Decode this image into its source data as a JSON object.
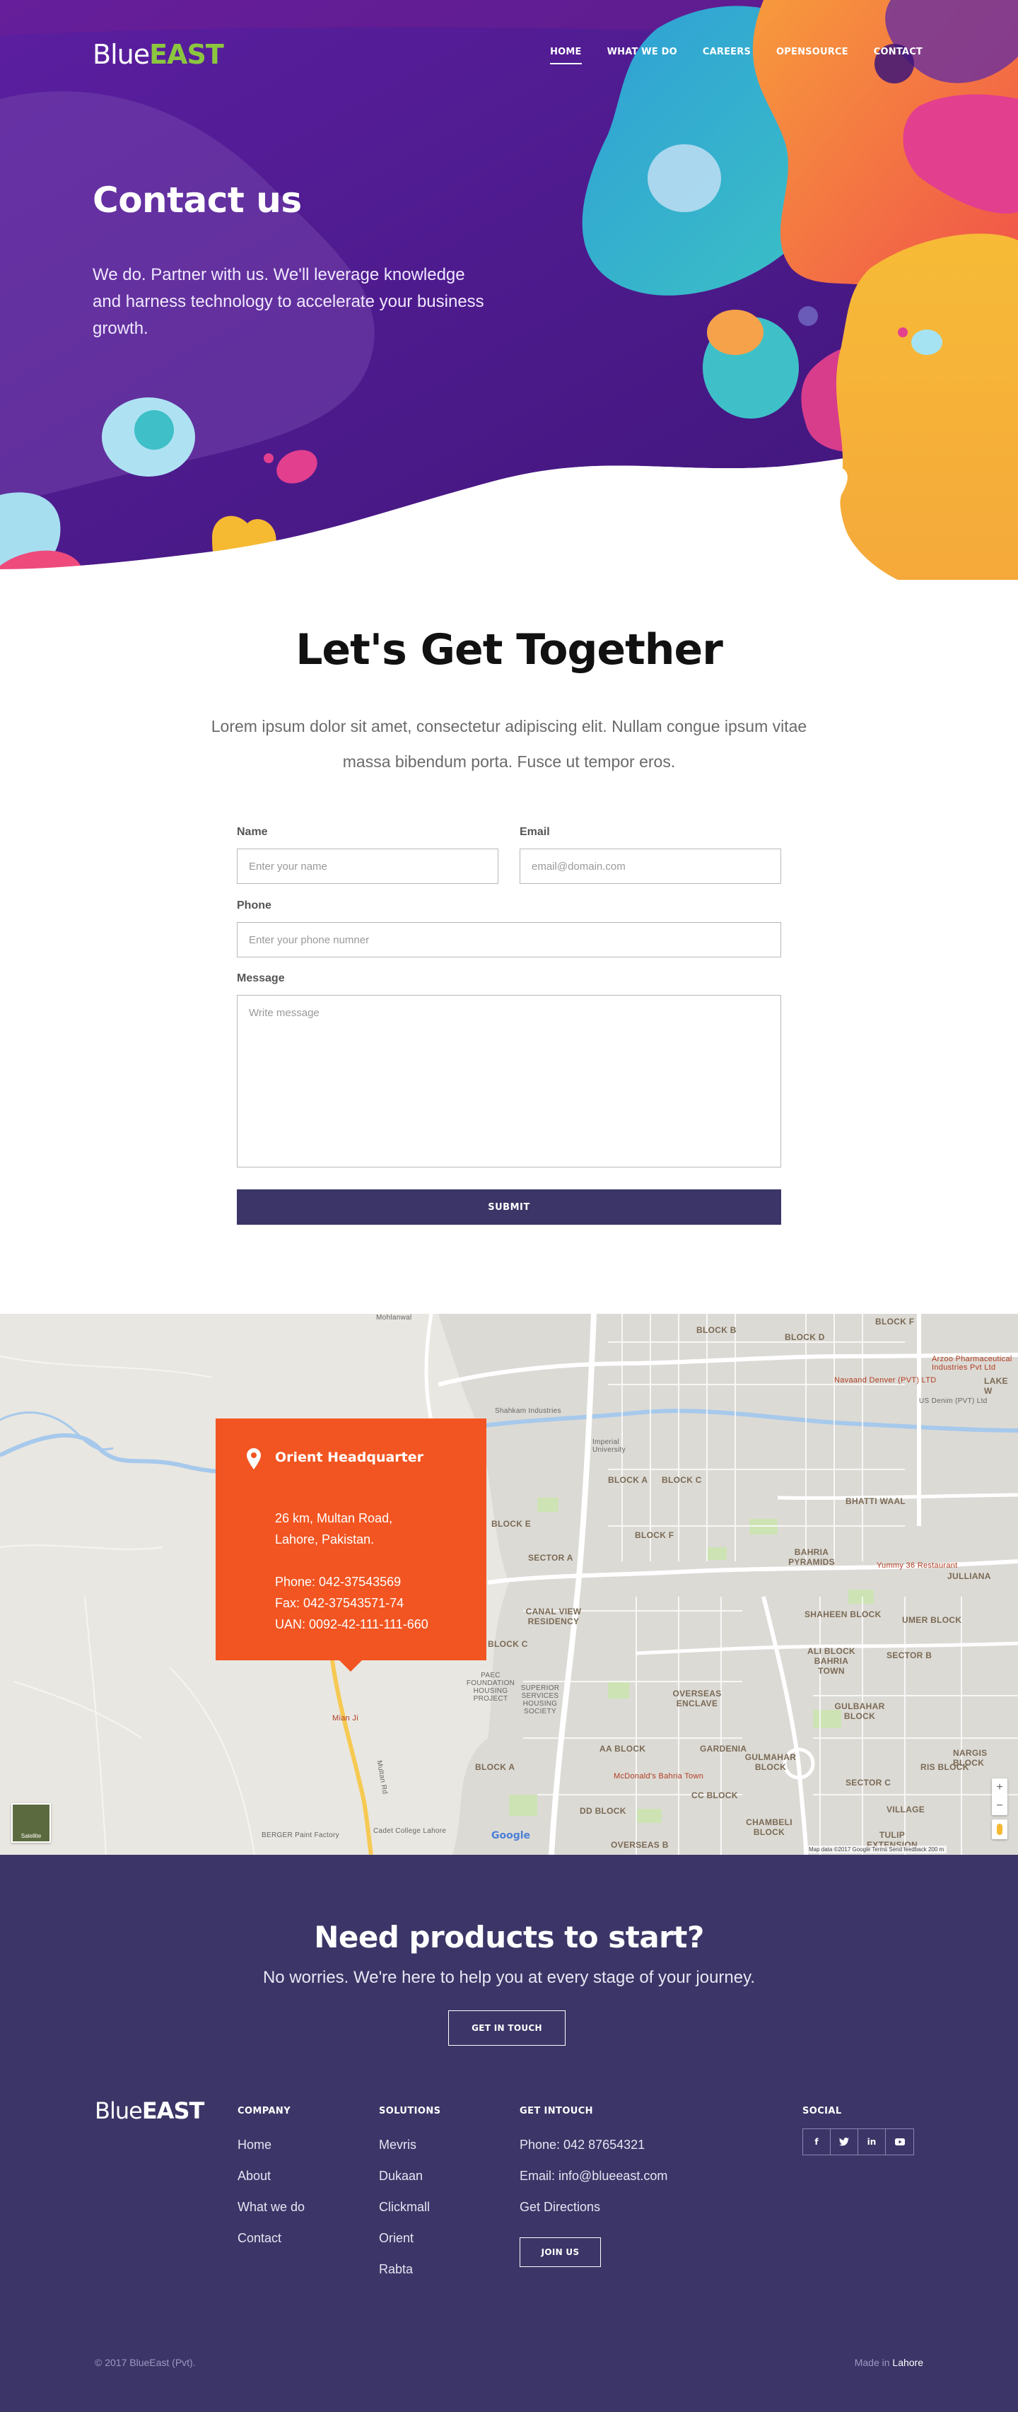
{
  "header": {
    "logo": {
      "part1": "Blue",
      "part2": "EAST"
    },
    "nav": [
      {
        "label": "HOME",
        "active": true
      },
      {
        "label": "WHAT WE DO",
        "active": false
      },
      {
        "label": "CAREERS",
        "active": false
      },
      {
        "label": "OPENSOURCE",
        "active": false
      },
      {
        "label": "CONTACT",
        "active": false
      }
    ]
  },
  "hero": {
    "title": "Contact us",
    "description": "We do. Partner with us. We'll leverage knowledge and harness technology to accelerate your business growth."
  },
  "together": {
    "title": "Let's Get Together",
    "description": "Lorem ipsum dolor sit amet, consectetur adipiscing elit. Nullam congue ipsum vitae massa bibendum porta. Fusce ut tempor eros."
  },
  "form": {
    "name_label": "Name",
    "name_placeholder": "Enter your name",
    "email_label": "Email",
    "email_placeholder": "email@domain.com",
    "phone_label": "Phone",
    "phone_placeholder": "Enter your phone numner",
    "message_label": "Message",
    "message_placeholder": "Write message",
    "submit_label": "SUBMIT"
  },
  "map": {
    "card": {
      "title": "Orient Headquarter",
      "address_line1": "26 km, Multan Road,",
      "address_line2": "Lahore, Pakistan.",
      "phone": "Phone: 042-37543569",
      "fax": "Fax: 042-37543571-74",
      "uan": "UAN: 0092-42-111-111-660"
    },
    "labels": {
      "block_d": "BLOCK D",
      "block_e": "BLOCK E",
      "block_a": "BLOCK A",
      "block_c": "BLOCK C",
      "block_f": "BLOCK F",
      "sector_a": "SECTOR A",
      "canal_view": "CANAL VIEW RESIDENCY",
      "bahria": "BAHRIA PYRAMIDS",
      "bhatti": "BHATTI WAAL",
      "shaheen": "SHAHEEN BLOCK",
      "umer": "UMER BLOCK",
      "jinnah": "JULLIANA",
      "overseas": "OVERSEAS ENCLAVE",
      "gulbahar": "GULBAHAR BLOCK",
      "sector_b": "SECTOR B",
      "sector_c": "SECTOR C",
      "ali_block": "ALI BLOCK BAHRIA TOWN",
      "gardenia": "GARDENIA",
      "aa_block": "AA BLOCK",
      "nargis": "NARGIS BLOCK",
      "tulip": "TULIP EXTENSION",
      "chambeli": "CHAMBELI BLOCK",
      "overseas_b": "OVERSEAS B",
      "dd_block": "DD BLOCK",
      "cc_block": "CC BLOCK",
      "gulmahar": "GULMAHAR BLOCK",
      "village": "VILLAGE",
      "paec": "PAEC FOUNDATION HOUSING PROJECT",
      "superior": "SUPERIOR SERVICES HOUSING SOCIETY",
      "ris_block": "RIS BLOCK",
      "block_a2": "BLOCK A",
      "block_c2": "BLOCK C",
      "block_b": "BLOCK B",
      "block_f2": "BLOCK F",
      "lake_w": "LAKE W",
      "mohlanwal": "Mohlanwal",
      "imperial": "Imperial University",
      "shalkam": "Shahkam Industries",
      "cadet": "Cadet College Lahore",
      "berger": "BERGER Paint Factory",
      "mian_ji": "Mian Ji",
      "ferozepur": "Multan Rd",
      "mcdonalds": "McDonald's Bahria Town",
      "yummy": "Yummy 36 Restaurant",
      "arzoo": "Arzoo Pharmaceutical Industries Pvt Ltd",
      "navaand": "Navaand Denver (PVT) LTD",
      "us_denim": "US Denim (PVT) Ltd"
    },
    "satellite": "Satellite",
    "google": "Google",
    "attribution": "Map data ©2017 Google   Terms   Send feedback   200 m"
  },
  "cta": {
    "title": "Need products to start?",
    "subtitle": "No worries. We're here to help you at every stage of your journey.",
    "button": "GET IN TOUCH"
  },
  "footer": {
    "logo": {
      "part1": "Blue",
      "part2": "EAST"
    },
    "company": {
      "title": "COMPANY",
      "items": [
        "Home",
        "About",
        "What we do",
        "Contact"
      ]
    },
    "solutions": {
      "title": "SOLUTIONS",
      "items": [
        "Mevris",
        "Dukaan",
        "Clickmall",
        "Orient",
        "Rabta"
      ]
    },
    "getintouch": {
      "title": "GET INTOUCH",
      "phone": "Phone: 042 87654321",
      "email": "Email: info@blueeast.com",
      "directions": "Get Directions",
      "join": "JOIN US"
    },
    "social": {
      "title": "SOCIAL",
      "icons": [
        "facebook-icon",
        "twitter-icon",
        "linkedin-icon",
        "youtube-icon"
      ]
    },
    "copyright": "© 2017 BlueEast (Pvt).",
    "made_prefix": "Made in",
    "made_place": "Lahore"
  },
  "colors": {
    "purple": "#4a1a88",
    "footer": "#3b3667",
    "accent_green": "#8cc63f",
    "map_card": "#f25521"
  }
}
